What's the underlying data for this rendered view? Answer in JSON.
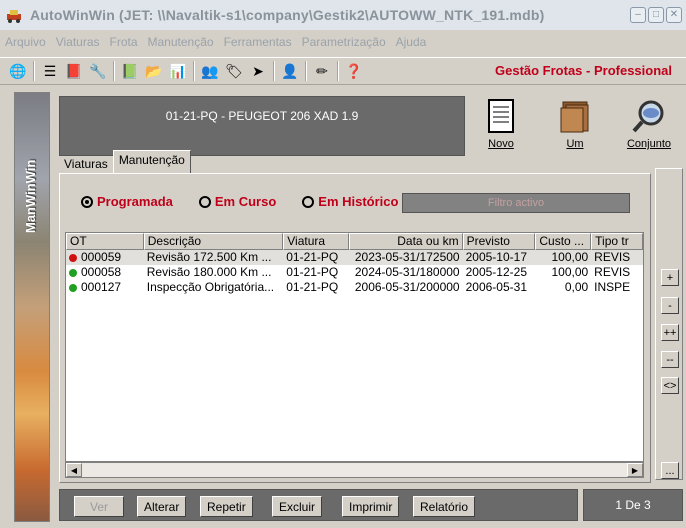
{
  "window": {
    "title": "AutoWinWin (JET: \\\\Navaltik-s1\\company\\Gestik2\\AUTOWW_NTK_191.mdb)"
  },
  "menu": [
    "Arquivo",
    "Viaturas",
    "Frota",
    "Manutenção",
    "Ferramentas",
    "Parametrização",
    "Ajuda"
  ],
  "brand": "Gestão Frotas - Professional",
  "sidebar_text": "ManWinWin",
  "vehicle": "01-21-PQ - PEUGEOT 206 XAD 1.9",
  "buttons": {
    "novo": "Novo",
    "um": "Um",
    "conjunto": "Conjunto"
  },
  "tabs": [
    "Viaturas",
    "Manutenção"
  ],
  "filters": {
    "programada": "Programada",
    "em_curso": "Em Curso",
    "em_historico": "Em Histórico",
    "filter_status": "Filtro activo"
  },
  "grid": {
    "headers": [
      "OT",
      "Descrição",
      "Viatura",
      "Data ou km",
      "Previsto",
      "Custo ...",
      "Tipo tr"
    ],
    "rows": [
      {
        "status": "late",
        "ot": "000059",
        "desc": "Revisão 172.500 Km ...",
        "viatura": "01-21-PQ",
        "data": "2023-05-31/172500",
        "previsto": "2005-10-17",
        "custo": "100,00",
        "tipo": "REVIS"
      },
      {
        "status": "ok",
        "ot": "000058",
        "desc": "Revisão 180.000 Km ...",
        "viatura": "01-21-PQ",
        "data": "2024-05-31/180000",
        "previsto": "2005-12-25",
        "custo": "100,00",
        "tipo": "REVIS"
      },
      {
        "status": "ok",
        "ot": "000127",
        "desc": "Inspecção Obrigatória...",
        "viatura": "01-21-PQ",
        "data": "2006-05-31/200000",
        "previsto": "2006-05-31",
        "custo": "0,00",
        "tipo": "INSPE"
      }
    ]
  },
  "side_buttons": [
    "+",
    "-",
    "++",
    "--",
    "<>",
    "..."
  ],
  "actions": {
    "ver": "Ver",
    "alterar": "Alterar",
    "repetir": "Repetir",
    "excluir": "Excluir",
    "imprimir": "Imprimir",
    "relatorio": "Relatório"
  },
  "pager": "1 De 3"
}
